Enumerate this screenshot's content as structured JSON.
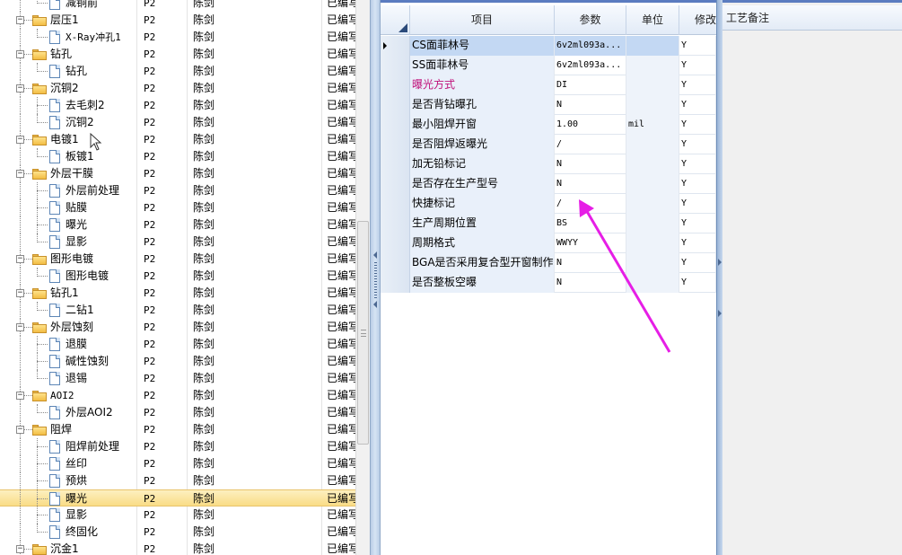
{
  "tree": {
    "rows": [
      {
        "level": 2,
        "icon": "doc",
        "name": "减铜前",
        "prio": "P2",
        "owner": "陈剑",
        "status": "已编写"
      },
      {
        "level": 1,
        "icon": "folder",
        "name": "层压1",
        "prio": "P2",
        "owner": "陈剑",
        "status": "已编写"
      },
      {
        "level": 2,
        "icon": "doc",
        "name": "X-Ray冲孔1",
        "prio": "P2",
        "owner": "陈剑",
        "status": "已编写"
      },
      {
        "level": 1,
        "icon": "folder",
        "name": "钻孔",
        "prio": "P2",
        "owner": "陈剑",
        "status": "已编写"
      },
      {
        "level": 2,
        "icon": "doc",
        "name": "钻孔",
        "prio": "P2",
        "owner": "陈剑",
        "status": "已编写"
      },
      {
        "level": 1,
        "icon": "folder",
        "name": "沉铜2",
        "prio": "P2",
        "owner": "陈剑",
        "status": "已编写"
      },
      {
        "level": 2,
        "icon": "doc",
        "name": "去毛刺2",
        "prio": "P2",
        "owner": "陈剑",
        "status": "已编写"
      },
      {
        "level": 2,
        "icon": "doc",
        "name": "沉铜2",
        "prio": "P2",
        "owner": "陈剑",
        "status": "已编写"
      },
      {
        "level": 1,
        "icon": "folder",
        "name": "电镀1",
        "prio": "P2",
        "owner": "陈剑",
        "status": "已编写"
      },
      {
        "level": 2,
        "icon": "doc",
        "name": "板镀1",
        "prio": "P2",
        "owner": "陈剑",
        "status": "已编写"
      },
      {
        "level": 1,
        "icon": "folder",
        "name": "外层干膜",
        "prio": "P2",
        "owner": "陈剑",
        "status": "已编写"
      },
      {
        "level": 2,
        "icon": "doc",
        "name": "外层前处理",
        "prio": "P2",
        "owner": "陈剑",
        "status": "已编写"
      },
      {
        "level": 2,
        "icon": "doc",
        "name": "贴膜",
        "prio": "P2",
        "owner": "陈剑",
        "status": "已编写"
      },
      {
        "level": 2,
        "icon": "doc",
        "name": "曝光",
        "prio": "P2",
        "owner": "陈剑",
        "status": "已编写"
      },
      {
        "level": 2,
        "icon": "doc",
        "name": "显影",
        "prio": "P2",
        "owner": "陈剑",
        "status": "已编写"
      },
      {
        "level": 1,
        "icon": "folder",
        "name": "图形电镀",
        "prio": "P2",
        "owner": "陈剑",
        "status": "已编写"
      },
      {
        "level": 2,
        "icon": "doc",
        "name": "图形电镀",
        "prio": "P2",
        "owner": "陈剑",
        "status": "已编写"
      },
      {
        "level": 1,
        "icon": "folder",
        "name": "钻孔1",
        "prio": "P2",
        "owner": "陈剑",
        "status": "已编写"
      },
      {
        "level": 2,
        "icon": "doc",
        "name": "二钻1",
        "prio": "P2",
        "owner": "陈剑",
        "status": "已编写"
      },
      {
        "level": 1,
        "icon": "folder",
        "name": "外层蚀刻",
        "prio": "P2",
        "owner": "陈剑",
        "status": "已编写"
      },
      {
        "level": 2,
        "icon": "doc",
        "name": "退膜",
        "prio": "P2",
        "owner": "陈剑",
        "status": "已编写"
      },
      {
        "level": 2,
        "icon": "doc",
        "name": "碱性蚀刻",
        "prio": "P2",
        "owner": "陈剑",
        "status": "已编写"
      },
      {
        "level": 2,
        "icon": "doc",
        "name": "退锡",
        "prio": "P2",
        "owner": "陈剑",
        "status": "已编写"
      },
      {
        "level": 1,
        "icon": "folder",
        "name": "AOI2",
        "prio": "P2",
        "owner": "陈剑",
        "status": "已编写"
      },
      {
        "level": 2,
        "icon": "doc",
        "name": "外层AOI2",
        "prio": "P2",
        "owner": "陈剑",
        "status": "已编写"
      },
      {
        "level": 1,
        "icon": "folder",
        "name": "阻焊",
        "prio": "P2",
        "owner": "陈剑",
        "status": "已编写"
      },
      {
        "level": 2,
        "icon": "doc",
        "name": "阻焊前处理",
        "prio": "P2",
        "owner": "陈剑",
        "status": "已编写"
      },
      {
        "level": 2,
        "icon": "doc",
        "name": "丝印",
        "prio": "P2",
        "owner": "陈剑",
        "status": "已编写"
      },
      {
        "level": 2,
        "icon": "doc",
        "name": "预烘",
        "prio": "P2",
        "owner": "陈剑",
        "status": "已编写"
      },
      {
        "level": 2,
        "icon": "doc",
        "name": "曝光",
        "prio": "P2",
        "owner": "陈剑",
        "status": "已编写",
        "selected": true
      },
      {
        "level": 2,
        "icon": "doc",
        "name": "显影",
        "prio": "P2",
        "owner": "陈剑",
        "status": "已编写"
      },
      {
        "level": 2,
        "icon": "doc",
        "name": "终固化",
        "prio": "P2",
        "owner": "陈剑",
        "status": "已编写"
      },
      {
        "level": 1,
        "icon": "folder",
        "name": "沉金1",
        "prio": "P2",
        "owner": "陈剑",
        "status": "已编写"
      }
    ]
  },
  "params": {
    "headers": {
      "item": "项目",
      "value": "参数",
      "unit": "单位",
      "modify": "修改"
    },
    "rows": [
      {
        "item": "CS面菲林号",
        "value": "6v2ml093a...",
        "unit": "",
        "modify": "Y",
        "active": true
      },
      {
        "item": "SS面菲林号",
        "value": "6v2ml093a...",
        "unit": "",
        "modify": "Y"
      },
      {
        "item": "曝光方式",
        "value": "DI",
        "unit": "",
        "modify": "Y",
        "highlight": true
      },
      {
        "item": "是否背钻曝孔",
        "value": "N",
        "unit": "",
        "modify": "Y"
      },
      {
        "item": "最小阻焊开窗",
        "value": "1.00",
        "unit": "mil",
        "modify": "Y"
      },
      {
        "item": "是否阻焊返曝光",
        "value": "/",
        "unit": "",
        "modify": "Y"
      },
      {
        "item": "加无铅标记",
        "value": "N",
        "unit": "",
        "modify": "Y"
      },
      {
        "item": "是否存在生产型号",
        "value": "N",
        "unit": "",
        "modify": "Y"
      },
      {
        "item": "快捷标记",
        "value": "/",
        "unit": "",
        "modify": "Y"
      },
      {
        "item": "生产周期位置",
        "value": "BS",
        "unit": "",
        "modify": "Y"
      },
      {
        "item": "周期格式",
        "value": "WWYY",
        "unit": "",
        "modify": "Y"
      },
      {
        "item": "BGA是否采用复合型开窗制作",
        "value": "N",
        "unit": "",
        "modify": "Y"
      },
      {
        "item": "是否整板空曝",
        "value": "N",
        "unit": "",
        "modify": "Y"
      }
    ]
  },
  "notes": {
    "title": "工艺备注"
  },
  "colors": {
    "annotation_arrow": "#e61ee6",
    "selected_row": "#f9dc86",
    "highlight_text": "#c0127a"
  },
  "icons": [
    "tree-toggle-icon",
    "folder-icon",
    "document-icon",
    "mouse-cursor-icon",
    "row-indicator-icon",
    "annotation-arrow"
  ]
}
